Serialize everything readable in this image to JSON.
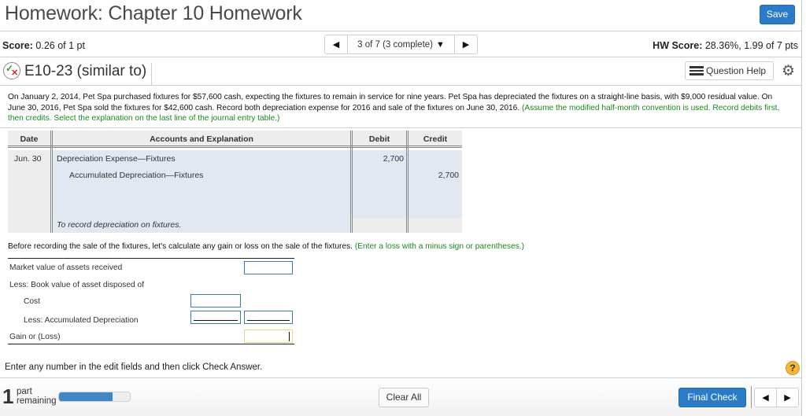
{
  "header": {
    "title": "Homework: Chapter 10 Homework",
    "save_label": "Save"
  },
  "score_bar": {
    "score_label": "Score:",
    "score_value": "0.26 of 1 pt",
    "nav_label": "3 of 7 (3 complete)",
    "prev_icon": "◀",
    "next_icon": "▶",
    "caret_icon": "▼",
    "hw_score_label": "HW Score:",
    "hw_score_value": "28.36%, 1.99 of 7 pts"
  },
  "question_bar": {
    "status_icon": "partially-correct-icon",
    "question_id": "E10-23 (similar to)",
    "help_label": "Question Help",
    "settings_icon": "gear-icon"
  },
  "problem": {
    "text_black": "On January 2, 2014, Pet Spa purchased fixtures for $57,600 cash, expecting the fixtures to remain in service for nine years.  Pet Spa has depreciated the fixtures on a straight-line basis, with $9,000 residual value. On June 30, 2016, Pet Spa sold the fixtures for $42,600 cash. Record both depreciation expense for 2016 and sale of the fixtures on June 30, 2016.",
    "text_green": "(Assume the modified half-month convention is used. Record debits first, then credits. Select the explanation on the last line of the journal entry table.)"
  },
  "journal": {
    "headers": [
      "Date",
      "Accounts and Explanation",
      "Debit",
      "Credit"
    ],
    "rows": [
      {
        "date": "Jun. 30",
        "account": "Depreciation Expense—Fixtures",
        "debit": "2,700",
        "credit": ""
      },
      {
        "date": "",
        "account": "Accumulated Depreciation—Fixtures",
        "debit": "",
        "credit": "2,700"
      }
    ],
    "explanation": "To record depreciation on fixtures."
  },
  "calc": {
    "intro_black": "Before recording the sale of the fixtures, let's calculate any gain or loss on the sale of the fixtures.",
    "intro_green": "(Enter a loss with a minus sign or parentheses.)",
    "rows": [
      {
        "label": "Market value of assets received",
        "value": ""
      },
      {
        "label": "Less: Book value of asset disposed of"
      },
      {
        "label": "Cost",
        "value": ""
      },
      {
        "label": "Less: Accumulated Depreciation",
        "value": "",
        "total": ""
      },
      {
        "label": "Gain or (Loss)",
        "value": ""
      }
    ]
  },
  "instructions": "Enter any number in the edit fields and then click Check Answer.",
  "help_icon_glyph": "?",
  "footer": {
    "parts_remaining_count": "1",
    "parts_label_line1": "part",
    "parts_label_line2": "remaining",
    "progress_fraction": 0.75,
    "clear_all_label": "Clear All",
    "final_check_label": "Final Check",
    "prev_icon": "◀",
    "next_icon": "▶"
  },
  "colors": {
    "primary_button": "#2a7bc8",
    "hint_green": "#1a8a1a",
    "journal_fill": "#e2e8f2",
    "progress_fill": "#3f88c8"
  }
}
